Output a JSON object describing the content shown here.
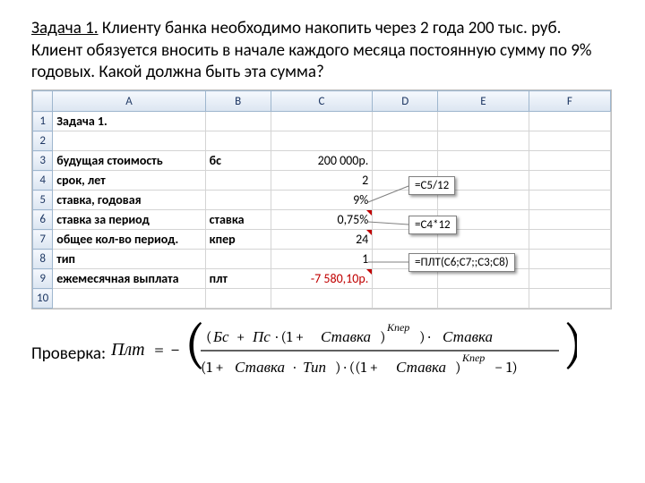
{
  "task_label": "Задача 1.",
  "problem_text": " Клиенту банка необходимо накопить  через 2 года 200 тыс. руб. Клиент обязуется вносить в начале каждого месяца постоянную сумму по 9% годовых. Какой должна быть эта сумма?",
  "columns": [
    "A",
    "B",
    "C",
    "D",
    "E",
    "F"
  ],
  "rows": [
    "1",
    "2",
    "3",
    "4",
    "5",
    "6",
    "7",
    "8",
    "9",
    "10"
  ],
  "cells": {
    "a1": "Задача 1.",
    "a3": "будущая стоимость",
    "b3": "бс",
    "c3": "200 000р.",
    "a4": "срок, лет",
    "c4": "2",
    "a5": "ставка, годовая",
    "c5": "9%",
    "a6": "ставка за период",
    "b6": "ставка",
    "c6": "0,75%",
    "a7": "общее кол-во период.",
    "b7": "кпер",
    "c7": "24",
    "a8": "тип",
    "c8": "1",
    "a9": "ежемесячная выплата",
    "b9": "плт",
    "c9": "-7 580,10р."
  },
  "callouts": {
    "box1": "=C5/12",
    "box2": "=C4*12",
    "box3": "=ПЛТ(C6;C7;;C3;C8)"
  },
  "check_label": "Проверка:",
  "formula": {
    "lhs": "Плт",
    "num_left": "Бс",
    "num_mid": "Пс",
    "one_plus_rate": "Ставка",
    "kper": "Кпер",
    "rate": "Ставка",
    "tip": "Тип"
  }
}
